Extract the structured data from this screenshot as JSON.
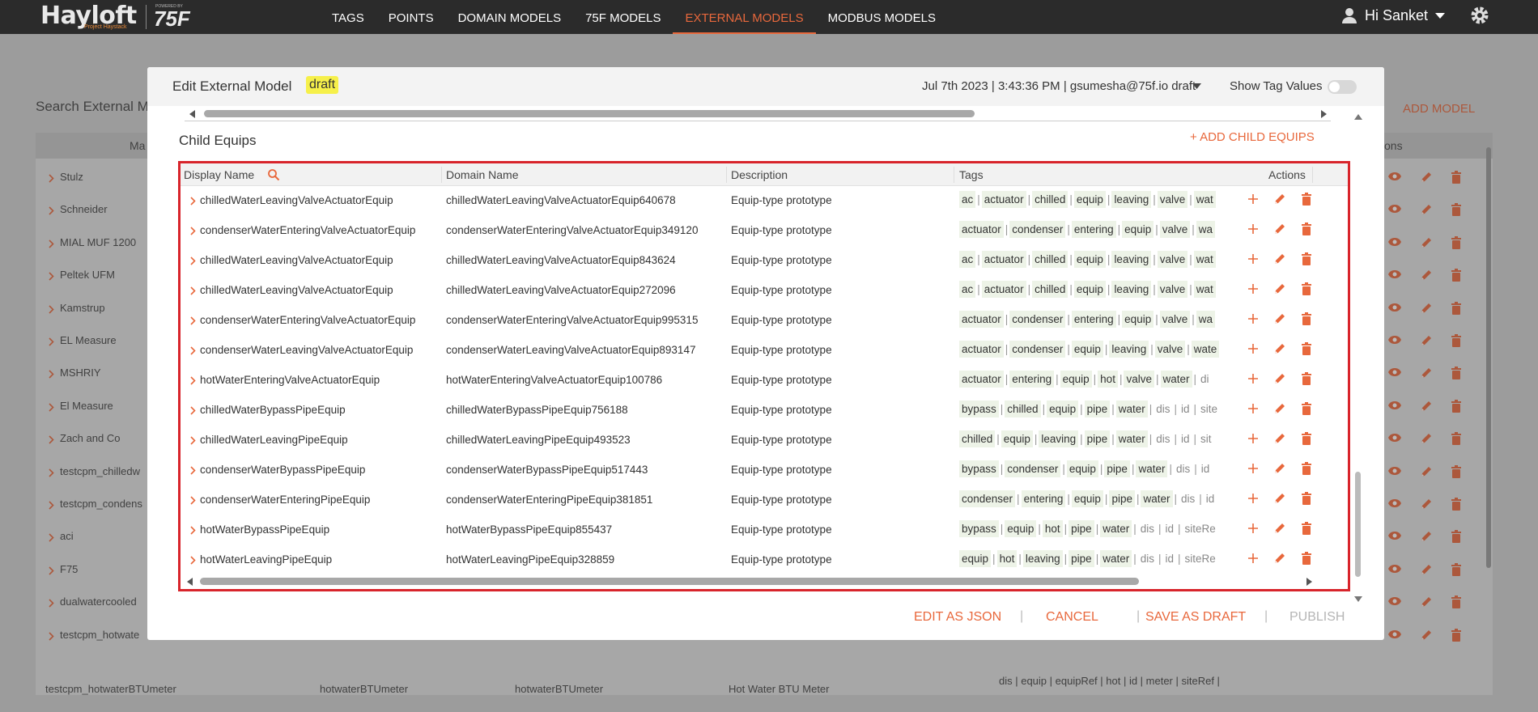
{
  "app": {
    "logo": "Hayloft",
    "logo_sub": "Project Haystack",
    "powered_by": "POWERED BY",
    "brand": "75F",
    "user_greeting": "Hi Sanket"
  },
  "nav": [
    {
      "label": "TAGS",
      "active": false
    },
    {
      "label": "POINTS",
      "active": false
    },
    {
      "label": "DOMAIN MODELS",
      "active": false
    },
    {
      "label": "75F MODELS",
      "active": false
    },
    {
      "label": "EXTERNAL MODELS",
      "active": true
    },
    {
      "label": "MODBUS MODELS",
      "active": false
    }
  ],
  "background": {
    "search_label": "Search External M",
    "add_model": "ADD MODEL",
    "column_left": "Ma",
    "column_right": "ons",
    "rows": [
      "Stulz",
      "Schneider",
      "MIAL MUF 1200",
      "Peltek UFM",
      "Kamstrup",
      "EL Measure",
      "MSHRIY",
      "El Measure",
      "Zach and Co",
      "testcpm_chilledw",
      "testcpm_condens",
      "aci",
      "F75",
      "dualwatercooled",
      "testcpm_hotwate"
    ],
    "bottom_row": {
      "name": "testcpm_hotwaterBTUmeter",
      "col2": "hotwaterBTUmeter",
      "col3": "hotwaterBTUmeter",
      "col4": "Hot Water BTU Meter",
      "tags": "dis | equip | equipRef | hot | id | meter | siteRef |"
    }
  },
  "modal": {
    "title": "Edit External Model",
    "badge": "draft",
    "meta": "Jul 7th 2023 | 3:43:36 PM | gsumesha@75f.io draft",
    "show_tag_values": "Show Tag Values",
    "section_title": "Child Equips",
    "add_child": "+ ADD CHILD EQUIPS",
    "columns": {
      "display_name": "Display Name",
      "domain_name": "Domain Name",
      "description": "Description",
      "tags": "Tags",
      "actions": "Actions"
    },
    "rows": [
      {
        "display": "chilledWaterLeavingValveActuatorEquip",
        "domain": "chilledWaterLeavingValveActuatorEquip640678",
        "description": "Equip-type prototype",
        "tags": [
          "ac",
          "actuator",
          "chilled",
          "equip",
          "leaving",
          "valve",
          "wat"
        ],
        "plain": []
      },
      {
        "display": "condenserWaterEnteringValveActuatorEquip",
        "domain": "condenserWaterEnteringValveActuatorEquip349120",
        "description": "Equip-type prototype",
        "tags": [
          "actuator",
          "condenser",
          "entering",
          "equip",
          "valve",
          "wa"
        ],
        "plain": []
      },
      {
        "display": "chilledWaterLeavingValveActuatorEquip",
        "domain": "chilledWaterLeavingValveActuatorEquip843624",
        "description": "Equip-type prototype",
        "tags": [
          "ac",
          "actuator",
          "chilled",
          "equip",
          "leaving",
          "valve",
          "wat"
        ],
        "plain": []
      },
      {
        "display": "chilledWaterLeavingValveActuatorEquip",
        "domain": "chilledWaterLeavingValveActuatorEquip272096",
        "description": "Equip-type prototype",
        "tags": [
          "ac",
          "actuator",
          "chilled",
          "equip",
          "leaving",
          "valve",
          "wat"
        ],
        "plain": []
      },
      {
        "display": "condenserWaterEnteringValveActuatorEquip",
        "domain": "condenserWaterEnteringValveActuatorEquip995315",
        "description": "Equip-type prototype",
        "tags": [
          "actuator",
          "condenser",
          "entering",
          "equip",
          "valve",
          "wa"
        ],
        "plain": []
      },
      {
        "display": "condenserWaterLeavingValveActuatorEquip",
        "domain": "condenserWaterLeavingValveActuatorEquip893147",
        "description": "Equip-type prototype",
        "tags": [
          "actuator",
          "condenser",
          "equip",
          "leaving",
          "valve",
          "wate"
        ],
        "plain": []
      },
      {
        "display": "hotWaterEnteringValveActuatorEquip",
        "domain": "hotWaterEnteringValveActuatorEquip100786",
        "description": "Equip-type prototype",
        "tags": [
          "actuator",
          "entering",
          "equip",
          "hot",
          "valve",
          "water"
        ],
        "plain": [
          "di"
        ]
      },
      {
        "display": "chilledWaterBypassPipeEquip",
        "domain": "chilledWaterBypassPipeEquip756188",
        "description": "Equip-type prototype",
        "tags": [
          "bypass",
          "chilled",
          "equip",
          "pipe",
          "water"
        ],
        "plain": [
          "dis",
          "id",
          "site"
        ]
      },
      {
        "display": "chilledWaterLeavingPipeEquip",
        "domain": "chilledWaterLeavingPipeEquip493523",
        "description": "Equip-type prototype",
        "tags": [
          "chilled",
          "equip",
          "leaving",
          "pipe",
          "water"
        ],
        "plain": [
          "dis",
          "id",
          "sit"
        ]
      },
      {
        "display": "condenserWaterBypassPipeEquip",
        "domain": "condenserWaterBypassPipeEquip517443",
        "description": "Equip-type prototype",
        "tags": [
          "bypass",
          "condenser",
          "equip",
          "pipe",
          "water"
        ],
        "plain": [
          "dis",
          "id"
        ]
      },
      {
        "display": "condenserWaterEnteringPipeEquip",
        "domain": "condenserWaterEnteringPipeEquip381851",
        "description": "Equip-type prototype",
        "tags": [
          "condenser",
          "entering",
          "equip",
          "pipe",
          "water"
        ],
        "plain": [
          "dis",
          "id"
        ]
      },
      {
        "display": "hotWaterBypassPipeEquip",
        "domain": "hotWaterBypassPipeEquip855437",
        "description": "Equip-type prototype",
        "tags": [
          "bypass",
          "equip",
          "hot",
          "pipe",
          "water"
        ],
        "plain": [
          "dis",
          "id",
          "siteRe"
        ]
      },
      {
        "display": "hotWaterLeavingPipeEquip",
        "domain": "hotWaterLeavingPipeEquip328859",
        "description": "Equip-type prototype",
        "tags": [
          "equip",
          "hot",
          "leaving",
          "pipe",
          "water"
        ],
        "plain": [
          "dis",
          "id",
          "siteRe"
        ]
      }
    ],
    "footer": {
      "edit_json": "EDIT AS JSON",
      "cancel": "CANCEL",
      "save_draft": "SAVE AS DRAFT",
      "publish": "PUBLISH",
      "separator": "|"
    }
  },
  "colors": {
    "accent": "#e8683c",
    "nav_bg": "#2b2b2b",
    "highlight_border": "#d8242b",
    "tag_bg": "#edf3e7",
    "badge": "#f6f04a"
  },
  "icons": [
    "search-icon",
    "chevron-right-icon",
    "plus-icon",
    "pencil-icon",
    "trash-icon",
    "eye-icon",
    "user-icon",
    "gear-icon",
    "caret-down-icon"
  ]
}
